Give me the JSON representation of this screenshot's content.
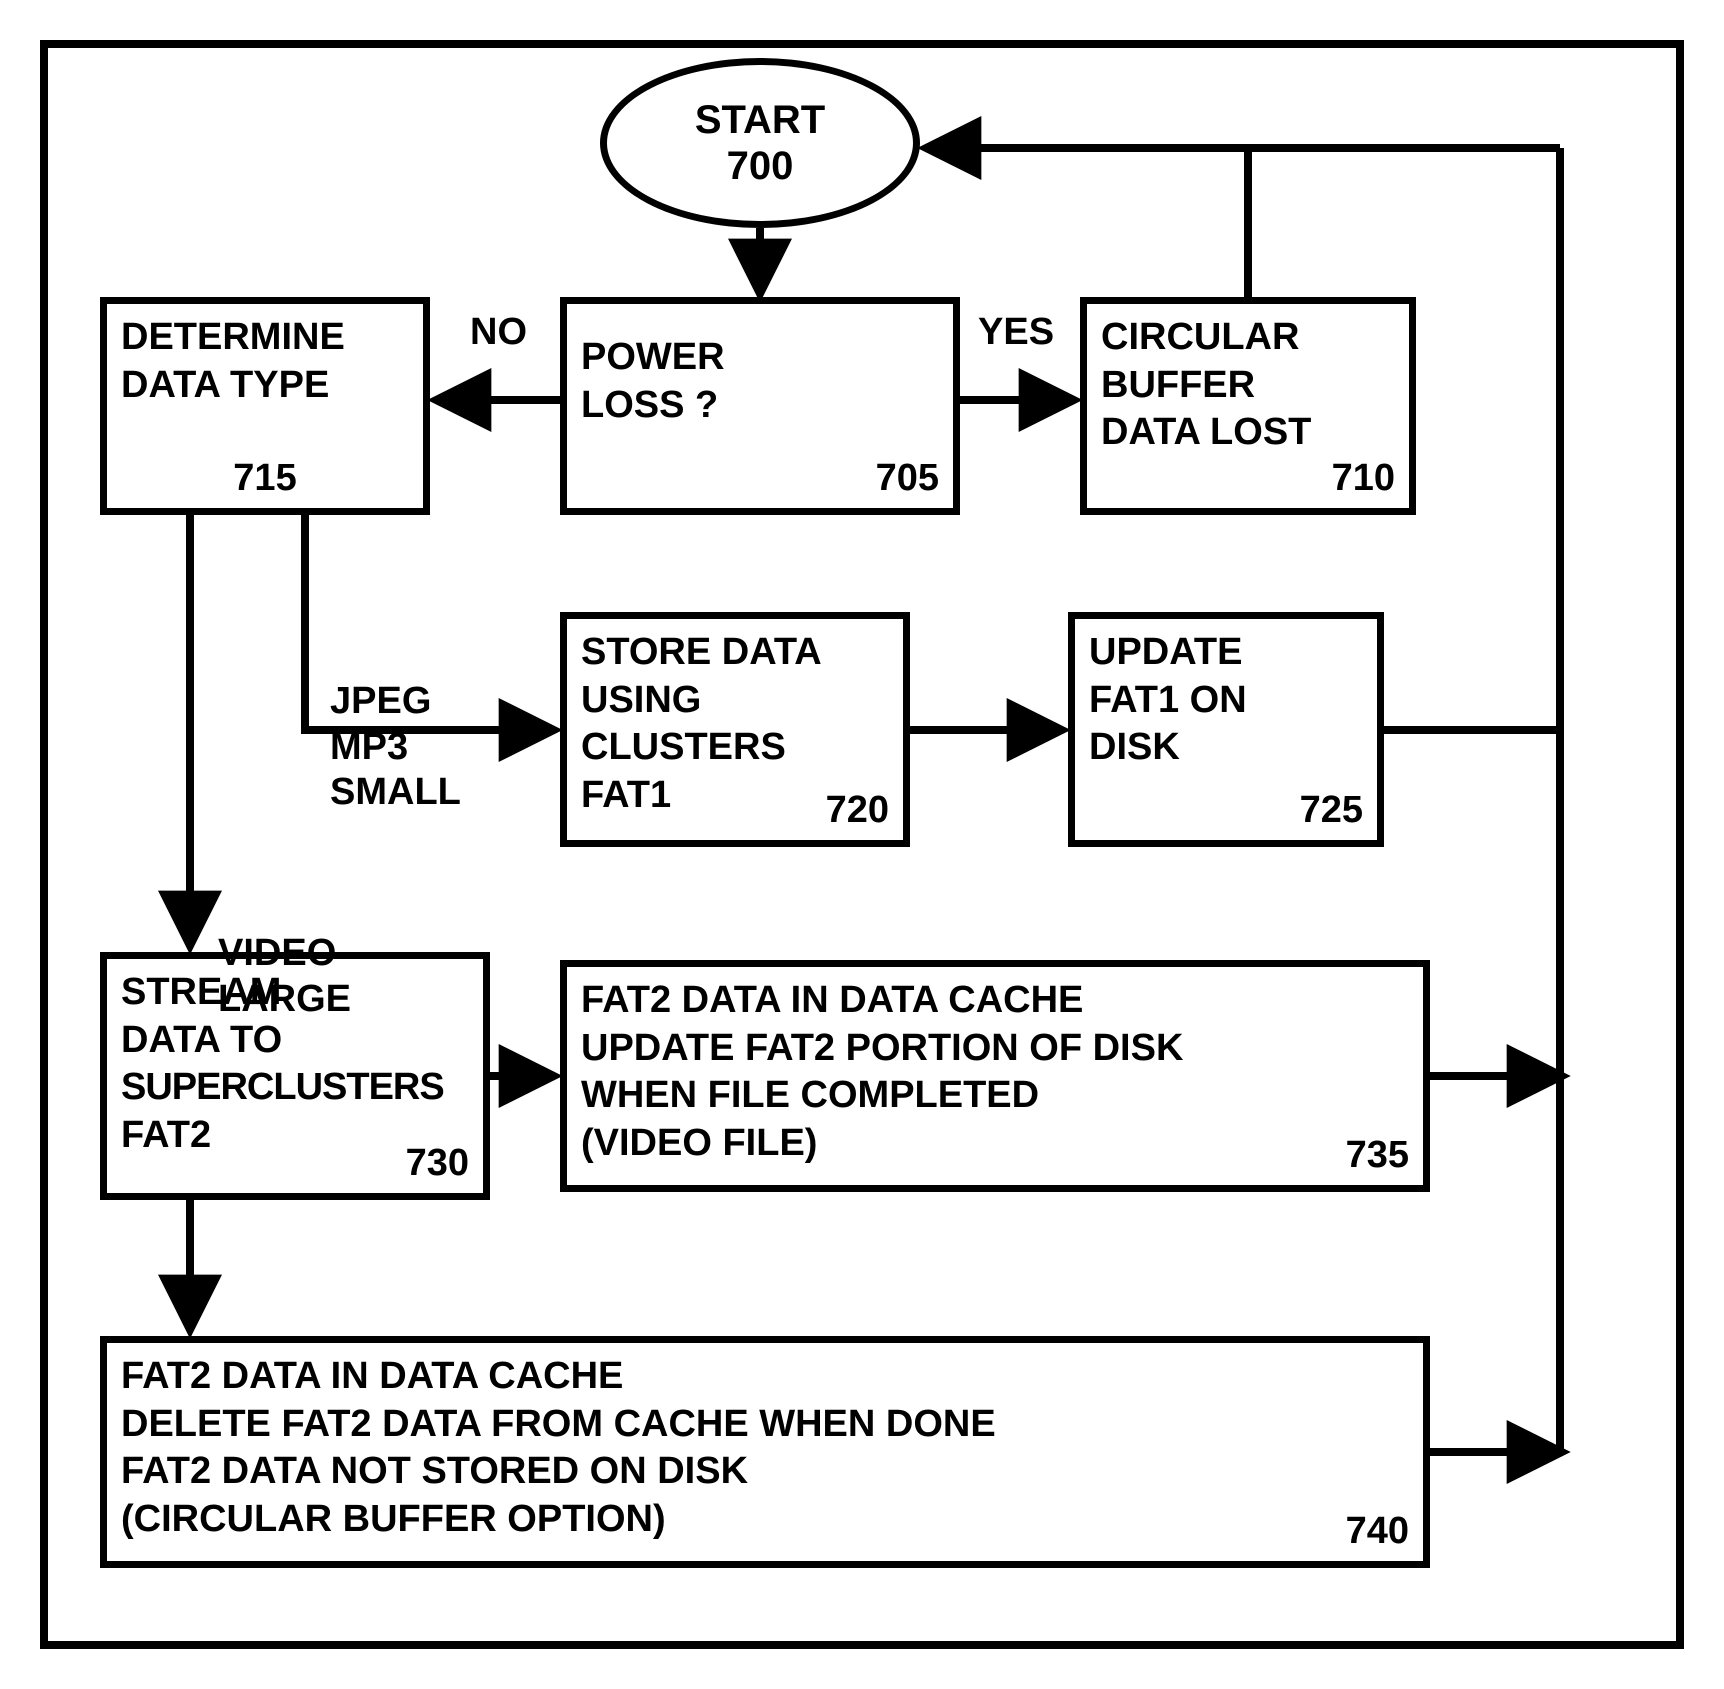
{
  "start": {
    "label": "START",
    "num": "700"
  },
  "powerloss": {
    "l1": "POWER",
    "l2": "LOSS ?",
    "num": "705"
  },
  "buffer": {
    "l1": "CIRCULAR",
    "l2": "BUFFER",
    "l3": "DATA LOST",
    "num": "710"
  },
  "determine": {
    "l1": "DETERMINE",
    "l2": "DATA TYPE",
    "num": "715"
  },
  "store": {
    "l1": "STORE DATA",
    "l2": "USING",
    "l3": "CLUSTERS",
    "l4": "FAT1",
    "num": "720"
  },
  "update": {
    "l1": "UPDATE",
    "l2": "FAT1 ON",
    "l3": "DISK",
    "num": "725"
  },
  "stream": {
    "l1": "STREAM",
    "l2": "DATA TO",
    "l3": "SUPERCLUSTERS",
    "l4": "FAT2",
    "num": "730"
  },
  "fat2a": {
    "l1": "FAT2 DATA IN DATA CACHE",
    "l2": "UPDATE FAT2 PORTION OF DISK",
    "l3": "WHEN FILE COMPLETED",
    "l4": "(VIDEO FILE)",
    "num": "735"
  },
  "fat2b": {
    "l1": "FAT2 DATA IN DATA CACHE",
    "l2": "DELETE FAT2 DATA FROM CACHE WHEN DONE",
    "l3": "FAT2 DATA NOT STORED ON DISK",
    "l4": "(CIRCULAR BUFFER OPTION)",
    "num": "740"
  },
  "edges": {
    "no": "NO",
    "yes": "YES",
    "jpeg": "JPEG\nMP3\nSMALL",
    "video": "VIDEO\nLARGE"
  }
}
